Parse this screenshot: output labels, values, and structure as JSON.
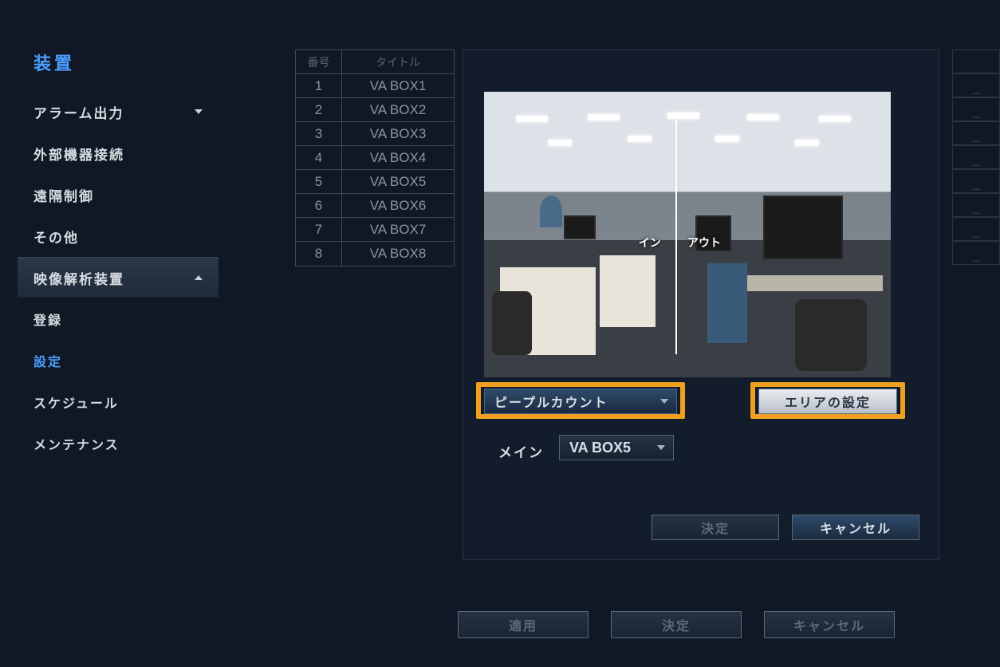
{
  "sidebar": {
    "title": "装置",
    "items": [
      {
        "label": "アラーム出力",
        "kind": "dropdown"
      },
      {
        "label": "外部機器接続",
        "kind": "plain"
      },
      {
        "label": "遠隔制御",
        "kind": "plain"
      },
      {
        "label": "その他",
        "kind": "plain"
      },
      {
        "label": "映像解析装置",
        "kind": "section-expanded"
      },
      {
        "label": "登録",
        "kind": "sub"
      },
      {
        "label": "設定",
        "kind": "sub-active"
      },
      {
        "label": "スケジュール",
        "kind": "sub"
      },
      {
        "label": "メンテナンス",
        "kind": "sub"
      }
    ]
  },
  "table": {
    "headers": {
      "num": "番号",
      "title": "タイトル"
    },
    "rows": [
      {
        "num": "1",
        "title": "VA BOX1"
      },
      {
        "num": "2",
        "title": "VA BOX2"
      },
      {
        "num": "3",
        "title": "VA BOX3"
      },
      {
        "num": "4",
        "title": "VA BOX4"
      },
      {
        "num": "5",
        "title": "VA BOX5"
      },
      {
        "num": "6",
        "title": "VA BOX6"
      },
      {
        "num": "7",
        "title": "VA BOX7"
      },
      {
        "num": "8",
        "title": "VA BOX8"
      }
    ]
  },
  "preview": {
    "in_label": "イン",
    "out_label": "アウト"
  },
  "controls": {
    "mode_dropdown": "ピープルカウント",
    "area_button": "エリアの設定",
    "main_label": "メイン",
    "main_value": "VA BOX5",
    "ok": "決定",
    "cancel": "キャンセル"
  },
  "footer": {
    "apply": "適用",
    "ok": "決定",
    "cancel": "キャンセル"
  },
  "colors": {
    "highlight": "#f0a020",
    "accent": "#4a9eff"
  }
}
